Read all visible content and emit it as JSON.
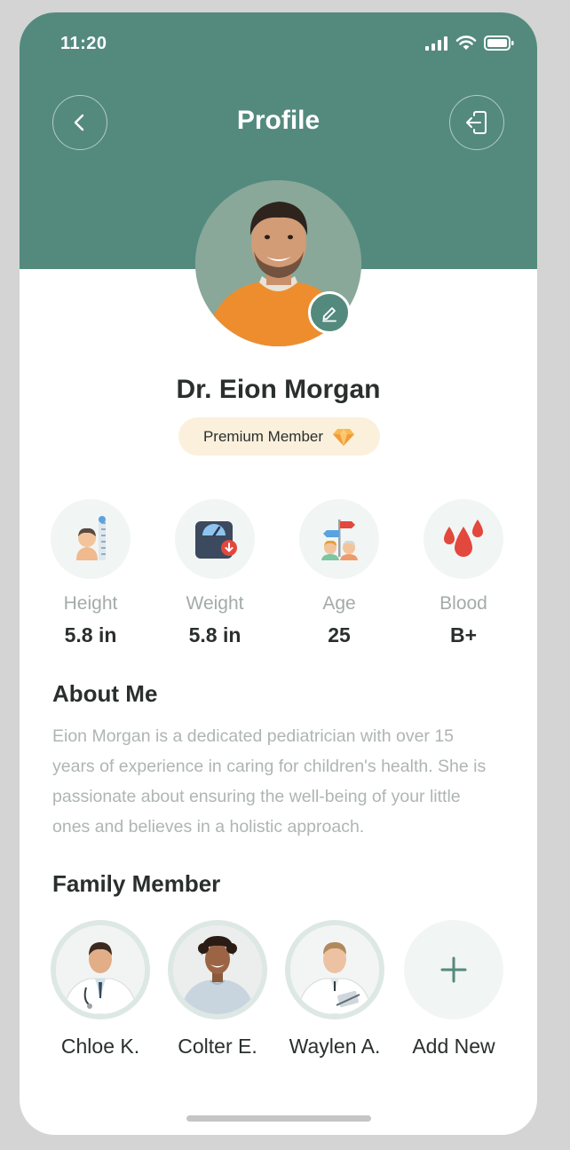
{
  "status_bar": {
    "time": "11:20",
    "icons": [
      "signal-icon",
      "wifi-icon",
      "battery-icon"
    ]
  },
  "header": {
    "title": "Profile",
    "back_icon": "chevron-left-icon",
    "logout_icon": "logout-icon"
  },
  "profile": {
    "name": "Dr. Eion Morgan",
    "badge": "Premium Member",
    "badge_icon": "diamond-icon",
    "edit_icon": "pencil-icon"
  },
  "stats": [
    {
      "label": "Height",
      "value": "5.8 in",
      "icon": "height-icon"
    },
    {
      "label": "Weight",
      "value": "5.8 in",
      "icon": "scale-icon"
    },
    {
      "label": "Age",
      "value": "25",
      "icon": "age-icon"
    },
    {
      "label": "Blood",
      "value": "B+",
      "icon": "blood-drop-icon"
    }
  ],
  "about": {
    "title": "About Me",
    "lines": [
      "Eion Morgan is a dedicated pediatrician with over 15",
      "years of experience in caring for children's health. She is",
      "passionate about ensuring the well-being of your little",
      "ones and believes in a holistic approach."
    ]
  },
  "family": {
    "title": "Family Member",
    "members": [
      {
        "name": "Chloe K."
      },
      {
        "name": "Colter E."
      },
      {
        "name": "Waylen A."
      },
      {
        "name": "Add New"
      }
    ]
  },
  "colors": {
    "primary": "#548a7e",
    "badge_bg": "#fbf0dc",
    "text_dark": "#2a2f2e",
    "text_muted": "#aeb5b4"
  }
}
